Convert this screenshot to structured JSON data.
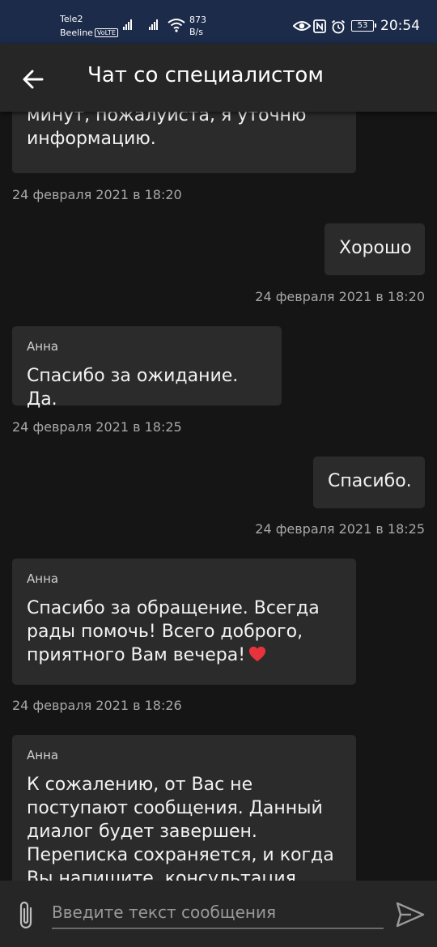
{
  "status_bar": {
    "carrier1": "Tele2",
    "carrier2": "Beeline",
    "volte": "VoLTE",
    "speed_value": "873",
    "speed_unit": "B/s",
    "battery": "53",
    "time": "20:54"
  },
  "header": {
    "title": "Чат со специалистом"
  },
  "messages": [
    {
      "type": "incoming",
      "text": "минут, пожалуйста, я уточню информацию.",
      "time": "24 февраля 2021 в 18:20"
    },
    {
      "type": "outgoing",
      "text": "Хорошо",
      "time": "24 февраля 2021 в 18:20"
    },
    {
      "type": "incoming",
      "sender": "Анна",
      "text": "Спасибо за ожидание. Да.",
      "time": "24 февраля 2021 в 18:25"
    },
    {
      "type": "outgoing",
      "text": "Спасибо.",
      "time": "24 февраля 2021 в 18:25"
    },
    {
      "type": "incoming",
      "sender": "Анна",
      "text": "Спасибо за обращение. Всегда рады помочь! Всего доброго, приятного Вам вечера!",
      "time": "24 февраля 2021 в 18:26"
    },
    {
      "type": "incoming",
      "sender": "Анна",
      "text": "К сожалению, от Вас не поступают сообщения. Данный диалог будет завершен. Переписка сохраняется, и когда Вы напишите, консультация будет"
    }
  ],
  "composer": {
    "placeholder": "Введите текст сообщения"
  },
  "colors": {
    "status_bar_bg": "#1c2b4a",
    "background": "#151515",
    "bubble": "#2b2b2b",
    "heart": "#e8323c"
  }
}
